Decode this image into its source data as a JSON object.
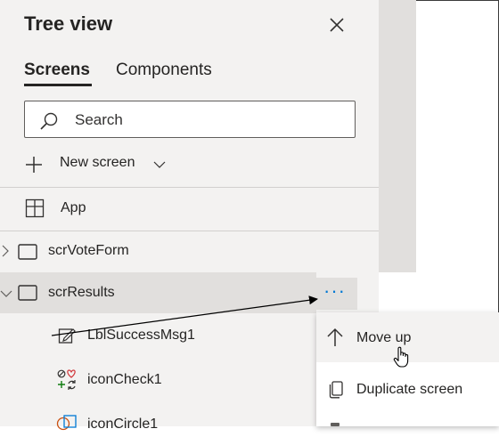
{
  "panel": {
    "title": "Tree view",
    "tabs": [
      {
        "label": "Screens",
        "active": true
      },
      {
        "label": "Components",
        "active": false
      }
    ],
    "search": {
      "placeholder": "Search"
    },
    "new_screen": {
      "label": "New screen"
    }
  },
  "tree": {
    "app": {
      "label": "App",
      "icon": "app-grid-icon"
    },
    "screens": [
      {
        "label": "scrVoteForm",
        "expanded": false,
        "icon": "screen-icon"
      },
      {
        "label": "scrResults",
        "expanded": true,
        "selected": true,
        "icon": "screen-icon"
      }
    ],
    "controls": [
      {
        "label": "LblSuccessMsg1",
        "icon": "label-edit-icon"
      },
      {
        "label": "iconCheck1",
        "icon": "icon-control-icon"
      },
      {
        "label": "iconCircle1",
        "icon": "shape-icon"
      }
    ],
    "more_button_label": "···"
  },
  "context_menu": {
    "items": [
      {
        "label": "Move up",
        "icon": "arrow-up-icon"
      },
      {
        "label": "Duplicate screen",
        "icon": "duplicate-icon"
      }
    ]
  },
  "colors": {
    "panel_bg": "#f3f2f1",
    "selected_bg": "#e1dfdd",
    "accent": "#0078d4",
    "text": "#252423"
  }
}
